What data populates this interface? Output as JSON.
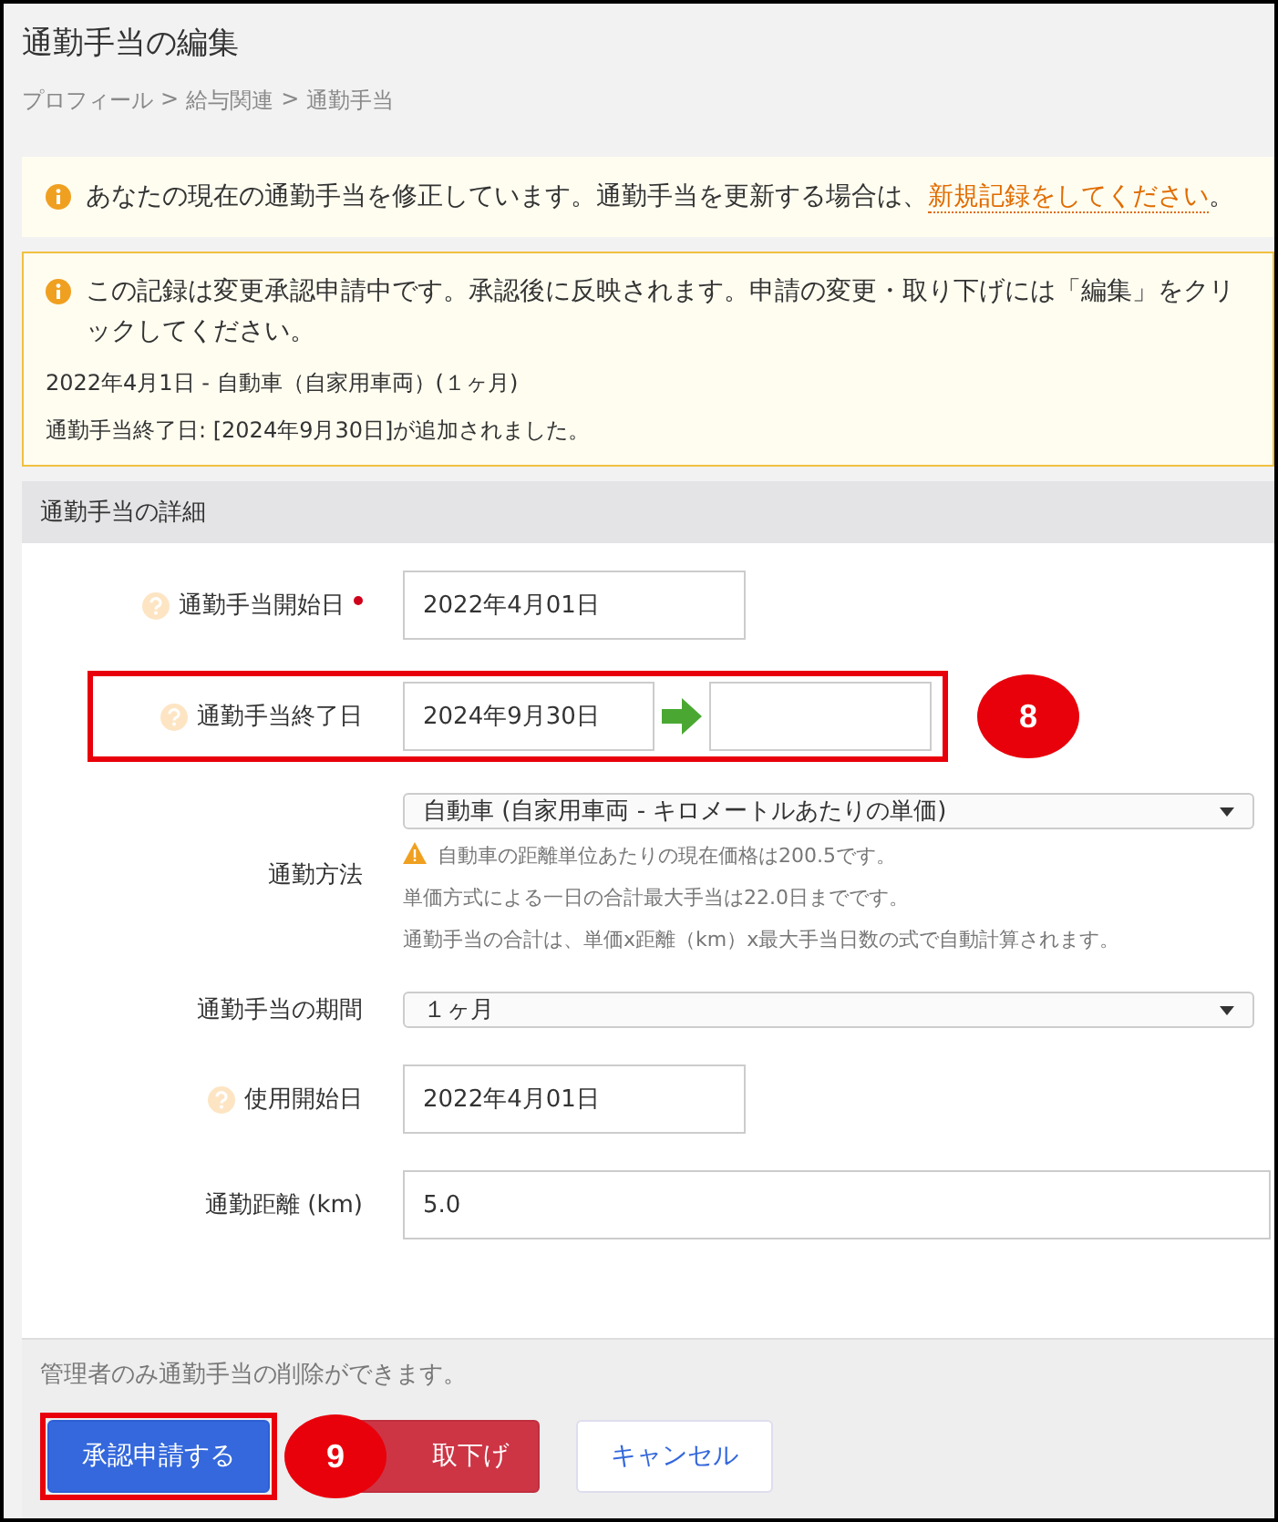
{
  "page": {
    "title": "通勤手当の編集",
    "breadcrumb": [
      "プロフィール",
      "給与関連",
      "通勤手当"
    ],
    "separator": ">"
  },
  "notices": [
    {
      "kind": "plain",
      "text": "あなたの現在の通勤手当を修正しています。通勤手当を更新する場合は、",
      "link": "新規記録をしてください",
      "tail": "。"
    },
    {
      "kind": "bordered",
      "text": "この記録は変更承認申請中です。承認後に反映されます。申請の変更・取り下げには「編集」をクリックしてください。",
      "details": [
        "2022年4月1日 - 自動車（自家用車両）(１ヶ月)",
        "通勤手当終了日: [2024年9月30日]が追加されました。"
      ]
    }
  ],
  "section": {
    "title": "通勤手当の詳細"
  },
  "fields": [
    {
      "kind": "date",
      "label": "通勤手当開始日",
      "help": true,
      "required": true,
      "value": "2022年4月01日",
      "highlighted": false
    },
    {
      "kind": "date_change",
      "label": "通勤手当終了日",
      "help": true,
      "required": false,
      "value": "2024年9月30日",
      "highlighted": true,
      "callout": "8"
    },
    {
      "kind": "select",
      "label": "通勤方法",
      "help": false,
      "required": false,
      "value": "自動車 (自家用車両 - キロメートルあたりの単価)",
      "warning": "自動車の距離単位あたりの現在価格は200.5です。",
      "notes": [
        "単価方式による一日の合計最大手当は22.0日までです。",
        "通勤手当の合計は、単価x距離（km）x最大手当日数の式で自動計算されます。"
      ],
      "highlighted": false
    },
    {
      "kind": "select",
      "label": "通勤手当の期間",
      "help": false,
      "required": false,
      "value": "１ヶ月",
      "highlighted": false
    },
    {
      "kind": "date",
      "label": "使用開始日",
      "help": true,
      "required": false,
      "value": "2022年4月01日",
      "highlighted": false
    },
    {
      "kind": "text",
      "label": "通勤距離 (km)",
      "help": false,
      "required": false,
      "value": "5.0",
      "highlighted": false
    }
  ],
  "footer": {
    "note": "管理者のみ通勤手当の削除ができます。",
    "buttons": [
      {
        "kind": "primary",
        "label": "承認申請する",
        "highlighted": true,
        "callout": "9"
      },
      {
        "kind": "danger",
        "label": "取下げ",
        "highlighted": false
      },
      {
        "kind": "default",
        "label": "キャンセル",
        "highlighted": false
      }
    ]
  }
}
